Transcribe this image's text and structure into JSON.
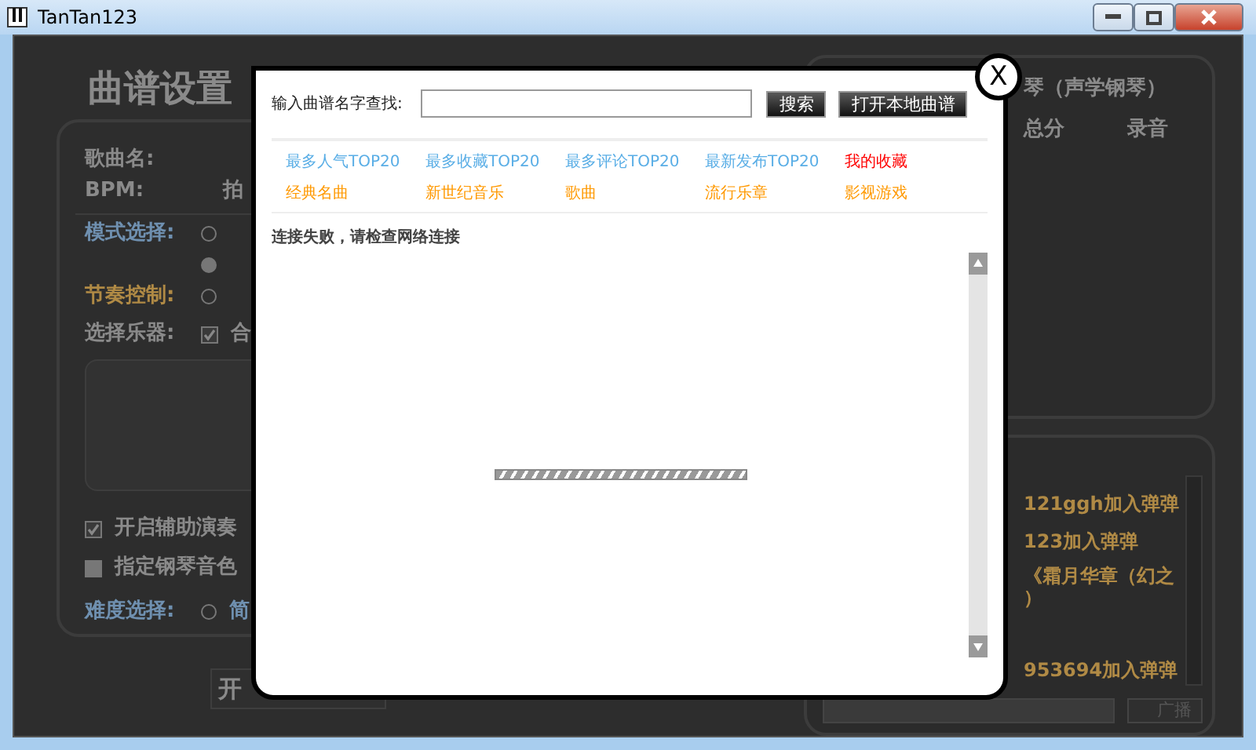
{
  "window": {
    "title": "TanTan123"
  },
  "settings": {
    "heading": "曲谱设置",
    "song_label": "歌曲名:",
    "bpm_label": "BPM:",
    "bpm_value": "拍",
    "mode_label": "模式选择:",
    "mode_radios": [
      {
        "selected": false
      },
      {
        "selected": true
      }
    ],
    "rhythm_label": "节奏控制:",
    "rhythm_radio": {
      "selected": false
    },
    "instrument_label": "选择乐器:",
    "instrument_check": {
      "checked": true,
      "label": "合"
    },
    "assist": {
      "checked": true,
      "label": "开启辅助演奏"
    },
    "piano_tone": {
      "checked": false,
      "label": "指定钢琴音色"
    },
    "difficulty_label": "难度选择:",
    "difficulty_radio": {
      "selected": false,
      "label": "简"
    },
    "buttons": [
      "开"
    ]
  },
  "score_panel": {
    "instrument": "琴（声学钢琴）",
    "columns": [
      "总分",
      "录音"
    ]
  },
  "chat": {
    "messages": [
      "121ggh加入弹弹",
      "123加入弹弹",
      "《霜月华章（幻之",
      "）",
      "953694加入弹弹"
    ],
    "broadcast_button": "广播"
  },
  "dialog": {
    "close": "X",
    "search_label": "输入曲谱名字查找:",
    "buttons": [
      "搜索",
      "打开本地曲谱"
    ],
    "categories": [
      [
        {
          "label": "最多人气TOP20",
          "color": "#5aaee6"
        },
        {
          "label": "最多收藏TOP20",
          "color": "#5aaee6"
        },
        {
          "label": "最多评论TOP20",
          "color": "#5aaee6"
        },
        {
          "label": "最新发布TOP20",
          "color": "#5aaee6"
        },
        {
          "label": "我的收藏",
          "color": "#ff0000"
        }
      ],
      [
        {
          "label": "经典名曲",
          "color": "#ff9900"
        },
        {
          "label": "新世纪音乐",
          "color": "#ff9900"
        },
        {
          "label": "歌曲",
          "color": "#ff9900"
        },
        {
          "label": "流行乐章",
          "color": "#ff9900"
        },
        {
          "label": "影视游戏",
          "color": "#ff9900"
        }
      ]
    ],
    "message": "连接失败，请检查网络连接"
  }
}
